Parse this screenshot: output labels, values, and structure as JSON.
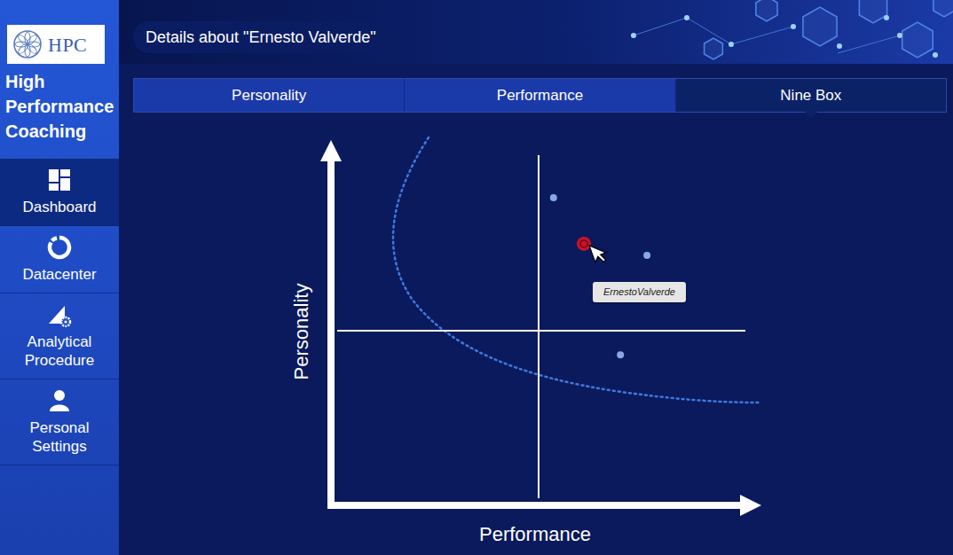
{
  "logo": {
    "text": "HPC"
  },
  "app_title": "High\nPerformance\nCoaching",
  "sidebar": {
    "items": [
      {
        "label": "Dashboard",
        "selected": true
      },
      {
        "label": "Datacenter",
        "selected": false
      },
      {
        "label": "Analytical Procedure",
        "selected": false
      },
      {
        "label": "Personal Settings",
        "selected": false
      }
    ]
  },
  "page_title": "Details about \"Ernesto Valverde\"",
  "tabs": [
    {
      "label": "Personality",
      "selected": false
    },
    {
      "label": "Performance",
      "selected": false
    },
    {
      "label": "Nine Box",
      "selected": true
    }
  ],
  "nine_box": {
    "x_label": "Performance",
    "y_label": "Personality",
    "tooltip": "ErnestoValverde",
    "points": [
      {
        "performance": 53.6,
        "personality": 88.1,
        "selected": false
      },
      {
        "performance": 60.9,
        "personality": 74.9,
        "selected": true
      },
      {
        "performance": 76.1,
        "personality": 71.6,
        "selected": false
      },
      {
        "performance": 69.7,
        "personality": 43.1,
        "selected": false
      }
    ]
  }
}
